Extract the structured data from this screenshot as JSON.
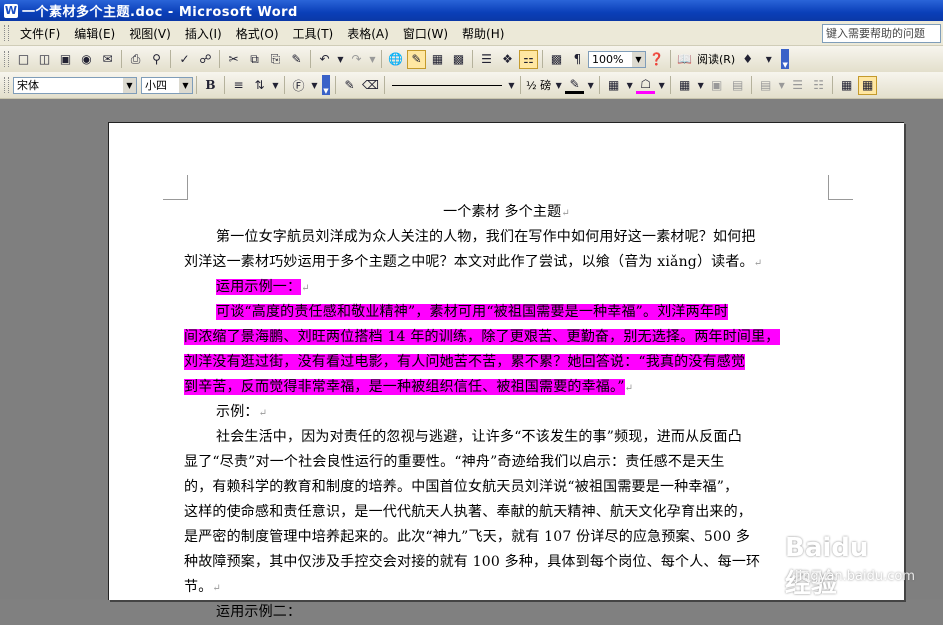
{
  "window": {
    "title": "一个素材多个主题.doc - Microsoft Word"
  },
  "menubar": {
    "items": [
      "文件(F)",
      "编辑(E)",
      "视图(V)",
      "插入(I)",
      "格式(O)",
      "工具(T)",
      "表格(A)",
      "窗口(W)",
      "帮助(H)"
    ],
    "help_placeholder": "键入需要帮助的问题"
  },
  "standard_toolbar": {
    "zoom": "100%",
    "read_label": "阅读(R)"
  },
  "format_toolbar": {
    "font": "宋体",
    "size": "小四",
    "line_weight": "½ 磅"
  },
  "document": {
    "title": "一个素材  多个主题",
    "para1": [
      "第一位女字航员刘洋成为众人关注的人物，我们在写作中如何用好这一素材呢？如何把",
      "刘洋这一素材巧妙运用于多个主题之中呢？本文对此作了尝试，以飨（音为 xiǎng）读者。"
    ],
    "example1_label": "运用示例一：",
    "para2": [
      "可谈“高度的责任感和敬业精神”，素材可用“被祖国需要是一种幸福”。刘洋两年时",
      "间浓缩了景海鹏、刘旺两位搭档 14 年的训练，除了更艰苦、更勤奋，别无选择。两年时间里，",
      "刘洋没有逛过街，没有看过电影，有人问她苦不苦，累不累？她回答说：“我真的没有感觉",
      "到辛苦，反而觉得非常幸福，是一种被组织信任、被祖国需要的幸福。”"
    ],
    "example_label": "示例：",
    "para3": [
      "社会生活中，因为对责任的忽视与逃避，让许多“不该发生的事”频现，进而从反面凸",
      "显了“尽责”对一个社会良性运行的重要性。“神舟”奇迹给我们以启示：责任感不是天生",
      "的，有赖科学的教育和制度的培养。中国首位女航天员刘洋说“被祖国需要是一种幸福”，",
      "这样的使命感和责任意识，是一代代航天人执著、奉献的航天精神、航天文化孕育出来的，",
      "是严密的制度管理中培养起来的。此次“神九”飞天，就有 107 份详尽的应急预案、500 多",
      "种故障预案，其中仅涉及手控交会对接的就有 100 多种，具体到每个岗位、每个人、每一环",
      "节。"
    ],
    "example2_label": "运用示例二："
  },
  "watermark": {
    "logo": "Baidu 经验",
    "url": "jingyan.baidu.com"
  }
}
